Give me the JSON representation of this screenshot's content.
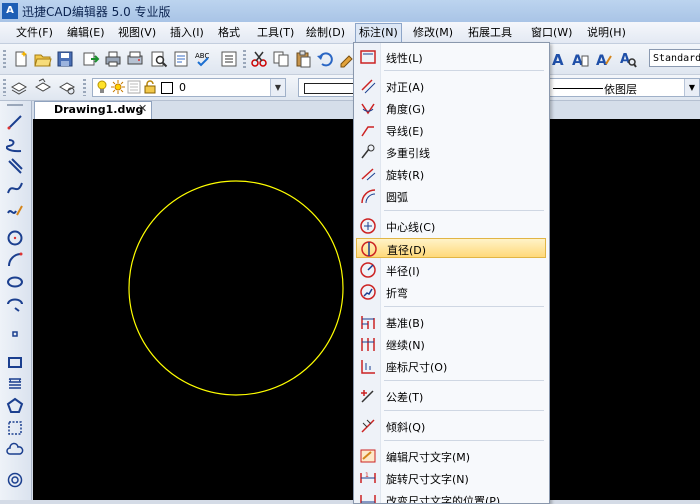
{
  "window": {
    "logo_text": "A",
    "title": "迅捷CAD编辑器 5.0 专业版"
  },
  "menubar": {
    "items": [
      "文件(F)",
      "编辑(E)",
      "视图(V)",
      "插入(I)",
      "格式",
      "工具(T)",
      "绘制(D)",
      "标注(N)",
      "修改(M)",
      "拓展工具",
      "窗口(W)",
      "说明(H)"
    ],
    "active": "标注(N)"
  },
  "toolbar": {
    "text_style": "Standard",
    "layer_name": "0",
    "bylayer_label": "依图层"
  },
  "document": {
    "tab_label": "Drawing1.dwg",
    "close_glyph": "✕"
  },
  "drawing": {
    "circle_color": "#ffff00",
    "background": "#000000"
  },
  "dimension_menu": {
    "items": [
      {
        "label": "线性(L)",
        "icon": "linear-dimension-icon"
      },
      {
        "label": "对正(A)",
        "icon": "aligned-dimension-icon"
      },
      {
        "label": "角度(G)",
        "icon": "angular-dimension-icon"
      },
      {
        "label": "导线(E)",
        "icon": "leader-icon"
      },
      {
        "label": "多重引线",
        "icon": "multileader-icon"
      },
      {
        "label": "旋转(R)",
        "icon": "rotated-dimension-icon"
      },
      {
        "label": "圆弧",
        "icon": "arc-length-icon"
      },
      {
        "label": "中心线(C)",
        "icon": "center-mark-icon"
      },
      {
        "label": "直径(D)",
        "icon": "diameter-icon"
      },
      {
        "label": "半径(I)",
        "icon": "radius-icon"
      },
      {
        "label": "折弯",
        "icon": "jogged-icon"
      },
      {
        "label": "基准(B)",
        "icon": "baseline-icon"
      },
      {
        "label": "继续(N)",
        "icon": "continue-icon"
      },
      {
        "label": "座标尺寸(O)",
        "icon": "ordinate-icon"
      },
      {
        "label": "公差(T)",
        "icon": "tolerance-icon"
      },
      {
        "label": "倾斜(Q)",
        "icon": "oblique-icon"
      },
      {
        "label": "编辑尺寸文字(M)",
        "icon": "edit-dimtext-icon"
      },
      {
        "label": "旋转尺寸文字(N)",
        "icon": "rotate-dimtext-icon"
      },
      {
        "label": "改变尺寸文字的位置(P)",
        "icon": "move-dimtext-icon"
      }
    ],
    "highlighted": "直径(D)"
  }
}
